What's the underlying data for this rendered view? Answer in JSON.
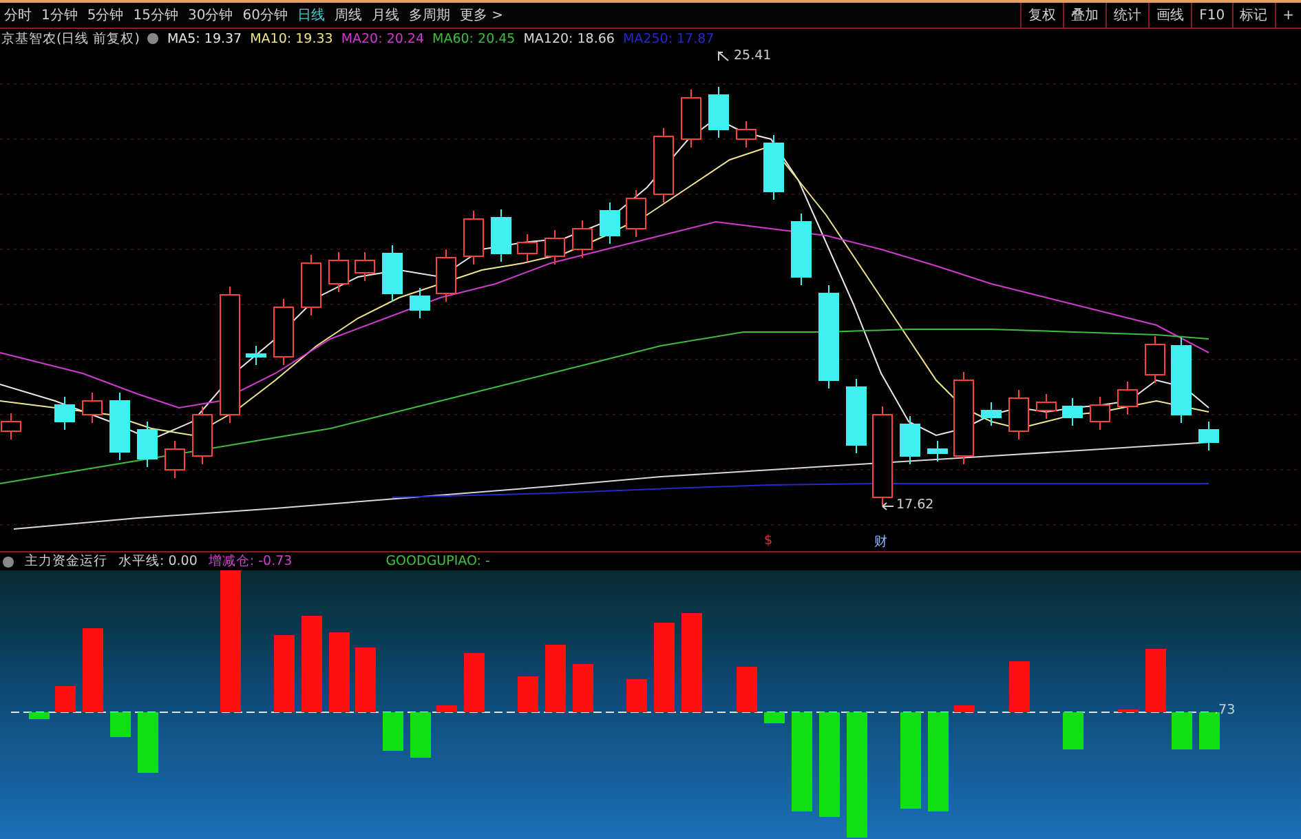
{
  "period_tabs": [
    {
      "label": "分时",
      "selected": false
    },
    {
      "label": "1分钟",
      "selected": false
    },
    {
      "label": "5分钟",
      "selected": false
    },
    {
      "label": "15分钟",
      "selected": false
    },
    {
      "label": "30分钟",
      "selected": false
    },
    {
      "label": "60分钟",
      "selected": false
    },
    {
      "label": "日线",
      "selected": true
    },
    {
      "label": "周线",
      "selected": false
    },
    {
      "label": "月线",
      "selected": false
    },
    {
      "label": "多周期",
      "selected": false
    },
    {
      "label": "更多 >",
      "selected": false
    }
  ],
  "tool_buttons": [
    "复权",
    "叠加",
    "统计",
    "画线",
    "F10",
    "标记",
    "+"
  ],
  "chart_legend": {
    "title": "京基智农(日线 前复权)",
    "averages": [
      {
        "label": "MA5: 19.37",
        "color": "#e8e8e8"
      },
      {
        "label": "MA10: 19.33",
        "color": "#f0e68c"
      },
      {
        "label": "MA20: 20.24",
        "color": "#d23ad2"
      },
      {
        "label": "MA60: 20.45",
        "color": "#3cbf3c"
      },
      {
        "label": "MA120: 18.66",
        "color": "#d8d8d8"
      },
      {
        "label": "MA250: 17.87",
        "color": "#2828c8"
      }
    ]
  },
  "price_marks": {
    "high": "25.41",
    "low": "17.62"
  },
  "event_marks": [
    {
      "label": "$",
      "color": "#e03030"
    },
    {
      "label": "财",
      "color": "#8ab4ff"
    }
  ],
  "indicator": {
    "title": "主力资金运行",
    "level_line": "水平线: 0.00",
    "change": "增减仓: -0.73",
    "extra": "GOODGUPIAO: -",
    "zero_label": ".73"
  }
}
